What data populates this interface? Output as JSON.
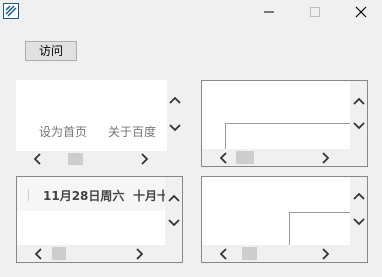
{
  "window": {
    "minimize_icon": "minimize-icon",
    "maximize_icon": "maximize-icon",
    "close_icon": "close-icon",
    "app_icon": "app-icon"
  },
  "toolbar": {
    "visit_label": "访问"
  },
  "panel_top_left": {
    "links": [
      "设为首页",
      "关于百度"
    ],
    "accent_color": "#3d6ec9"
  },
  "panel_bottom_left": {
    "date_text": "11月28日周六",
    "lunar_text": "十月十"
  },
  "colors": {
    "background": "#f0f0f0",
    "content": "#ffffff",
    "scroll_thumb": "#cdcdcd",
    "border": "#828790"
  }
}
